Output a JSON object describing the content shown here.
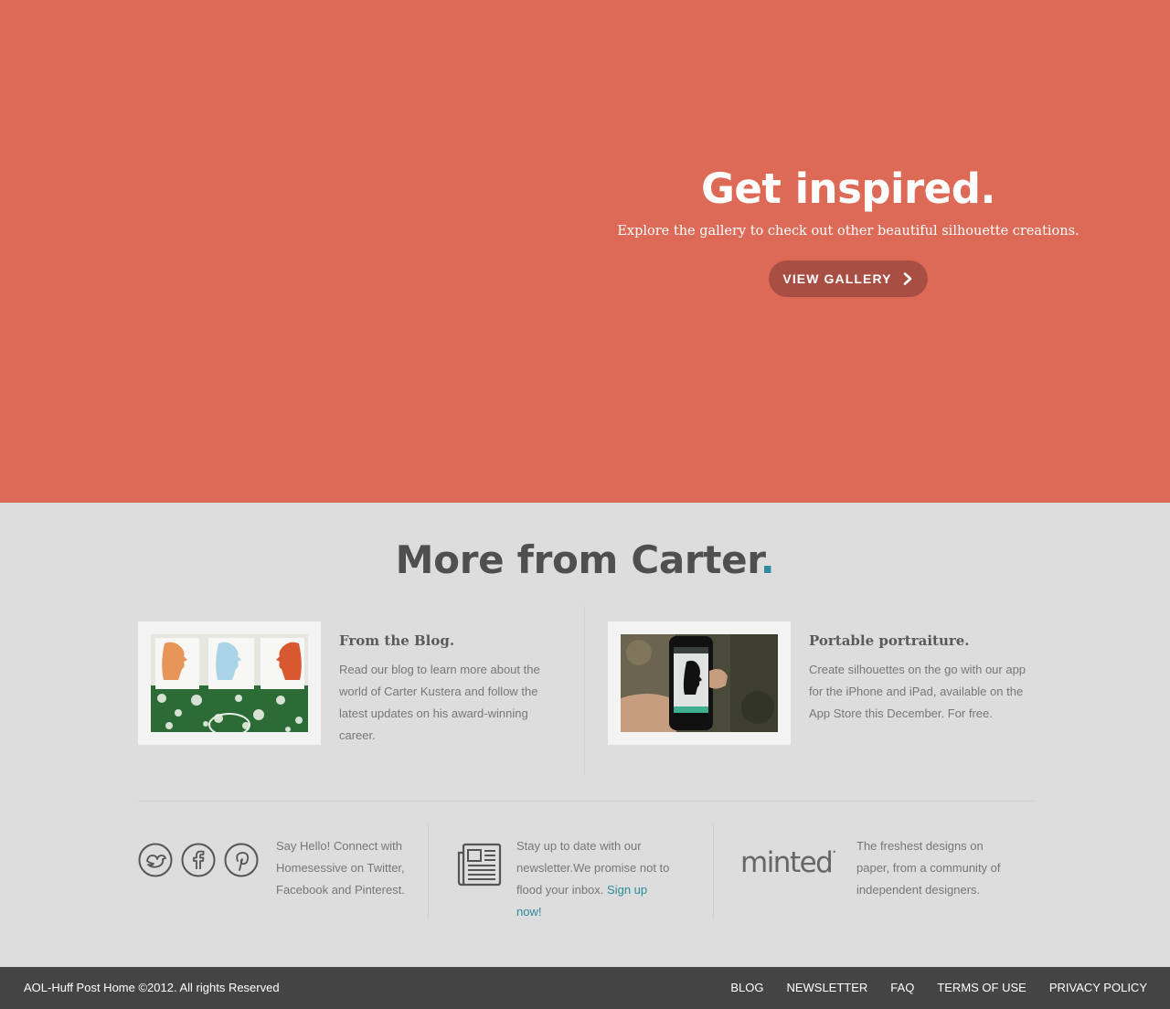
{
  "hero": {
    "title": "Get inspired.",
    "subtitle": "Explore the gallery to check out other beautiful silhouette creations.",
    "button_label": "VIEW GALLERY",
    "button_icon": "chevron-right-icon",
    "background_color": "#dd6a57",
    "button_color": "#a84e43"
  },
  "more": {
    "title": "More from Carter",
    "title_dot": ".",
    "accent_color": "#2e8b9b"
  },
  "features": [
    {
      "heading": "From the Blog.",
      "text": "Read our blog to learn more about the world of Carter Kustera and follow the latest updates on his award-winning career."
    },
    {
      "heading": "Portable portraiture.",
      "text": "Create silhouettes on the go with our app for the iPhone and iPad, available on the App Store this December. For free."
    }
  ],
  "social": {
    "icons": [
      "twitter-icon",
      "facebook-icon",
      "pinterest-icon"
    ],
    "text": "Say Hello! Connect with Homesessive on Twitter, Facebook and Pinterest."
  },
  "newsletter": {
    "icon": "newspaper-icon",
    "text": "Stay up to date with our newsletter.We promise not to flood your inbox.",
    "link_text": "Sign up now!"
  },
  "minted": {
    "logo_text": "minted",
    "text": "The freshest designs on paper, from a community of independent designers."
  },
  "footer": {
    "copyright": "AOL-Huff Post Home ©2012. All rights Reserved",
    "links": [
      "BLOG",
      "NEWSLETTER",
      "FAQ",
      "TERMS OF USE",
      "PRIVACY POLICY"
    ]
  }
}
